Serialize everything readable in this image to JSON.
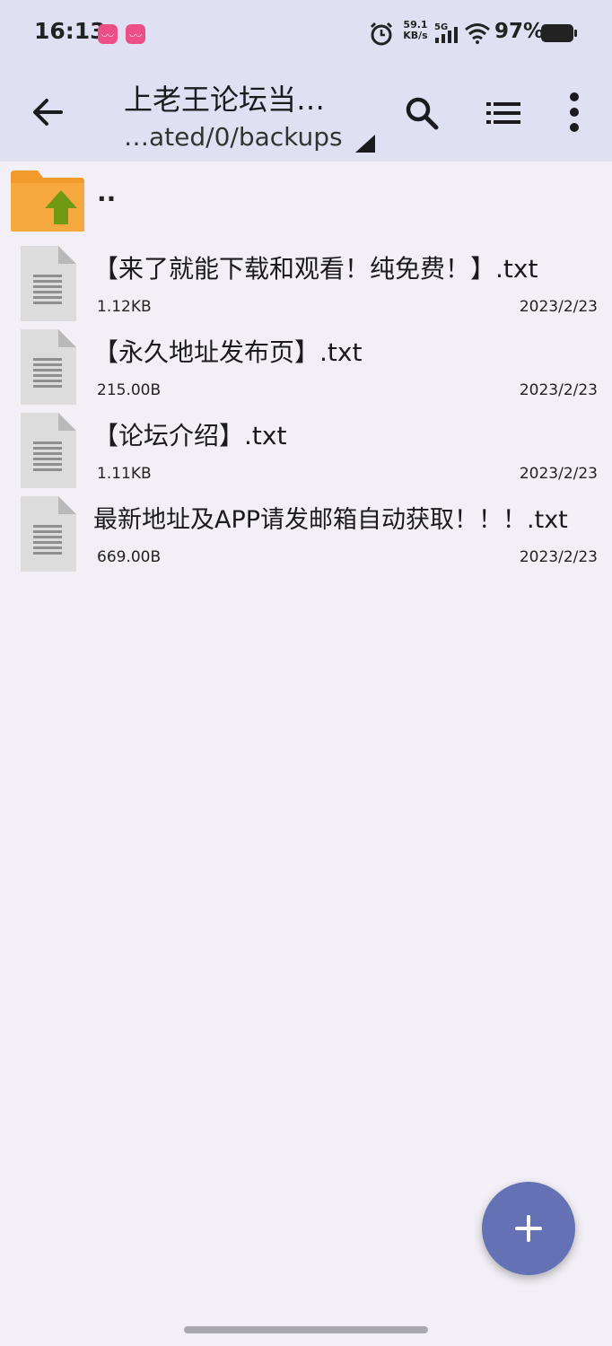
{
  "status_bar": {
    "time": "16:13",
    "notification_icons": [
      "app-notification-icon",
      "app-notification-icon"
    ],
    "net_speed_value": "59.1",
    "net_speed_unit": "KB/s",
    "network": "5G",
    "battery": "97%"
  },
  "app_bar": {
    "title": "上老王论坛当…",
    "subtitle": "…ated/0/backups",
    "icons": [
      "back-arrow-icon",
      "search-icon",
      "list-view-icon",
      "more-vert-icon"
    ]
  },
  "parent_entry": {
    "label": ".."
  },
  "files": [
    {
      "name": "【来了就能下载和观看！纯免费！】.txt",
      "size": "1.12KB",
      "date": "2023/2/23"
    },
    {
      "name": "【永久地址发布页】.txt",
      "size": "215.00B",
      "date": "2023/2/23"
    },
    {
      "name": "【论坛介绍】.txt",
      "size": "1.11KB",
      "date": "2023/2/23"
    },
    {
      "name": "最新地址及APP请发邮箱自动获取！！！.txt",
      "size": "669.00B",
      "date": "2023/2/23"
    }
  ],
  "fab": {
    "icon": "plus-icon"
  },
  "colors": {
    "app_bar_bg": "#dfe1f3",
    "page_bg": "#f2f0f6",
    "fab": "#6472b5",
    "folder": "#f7a23b",
    "folder_arrow": "#6f9a12"
  }
}
